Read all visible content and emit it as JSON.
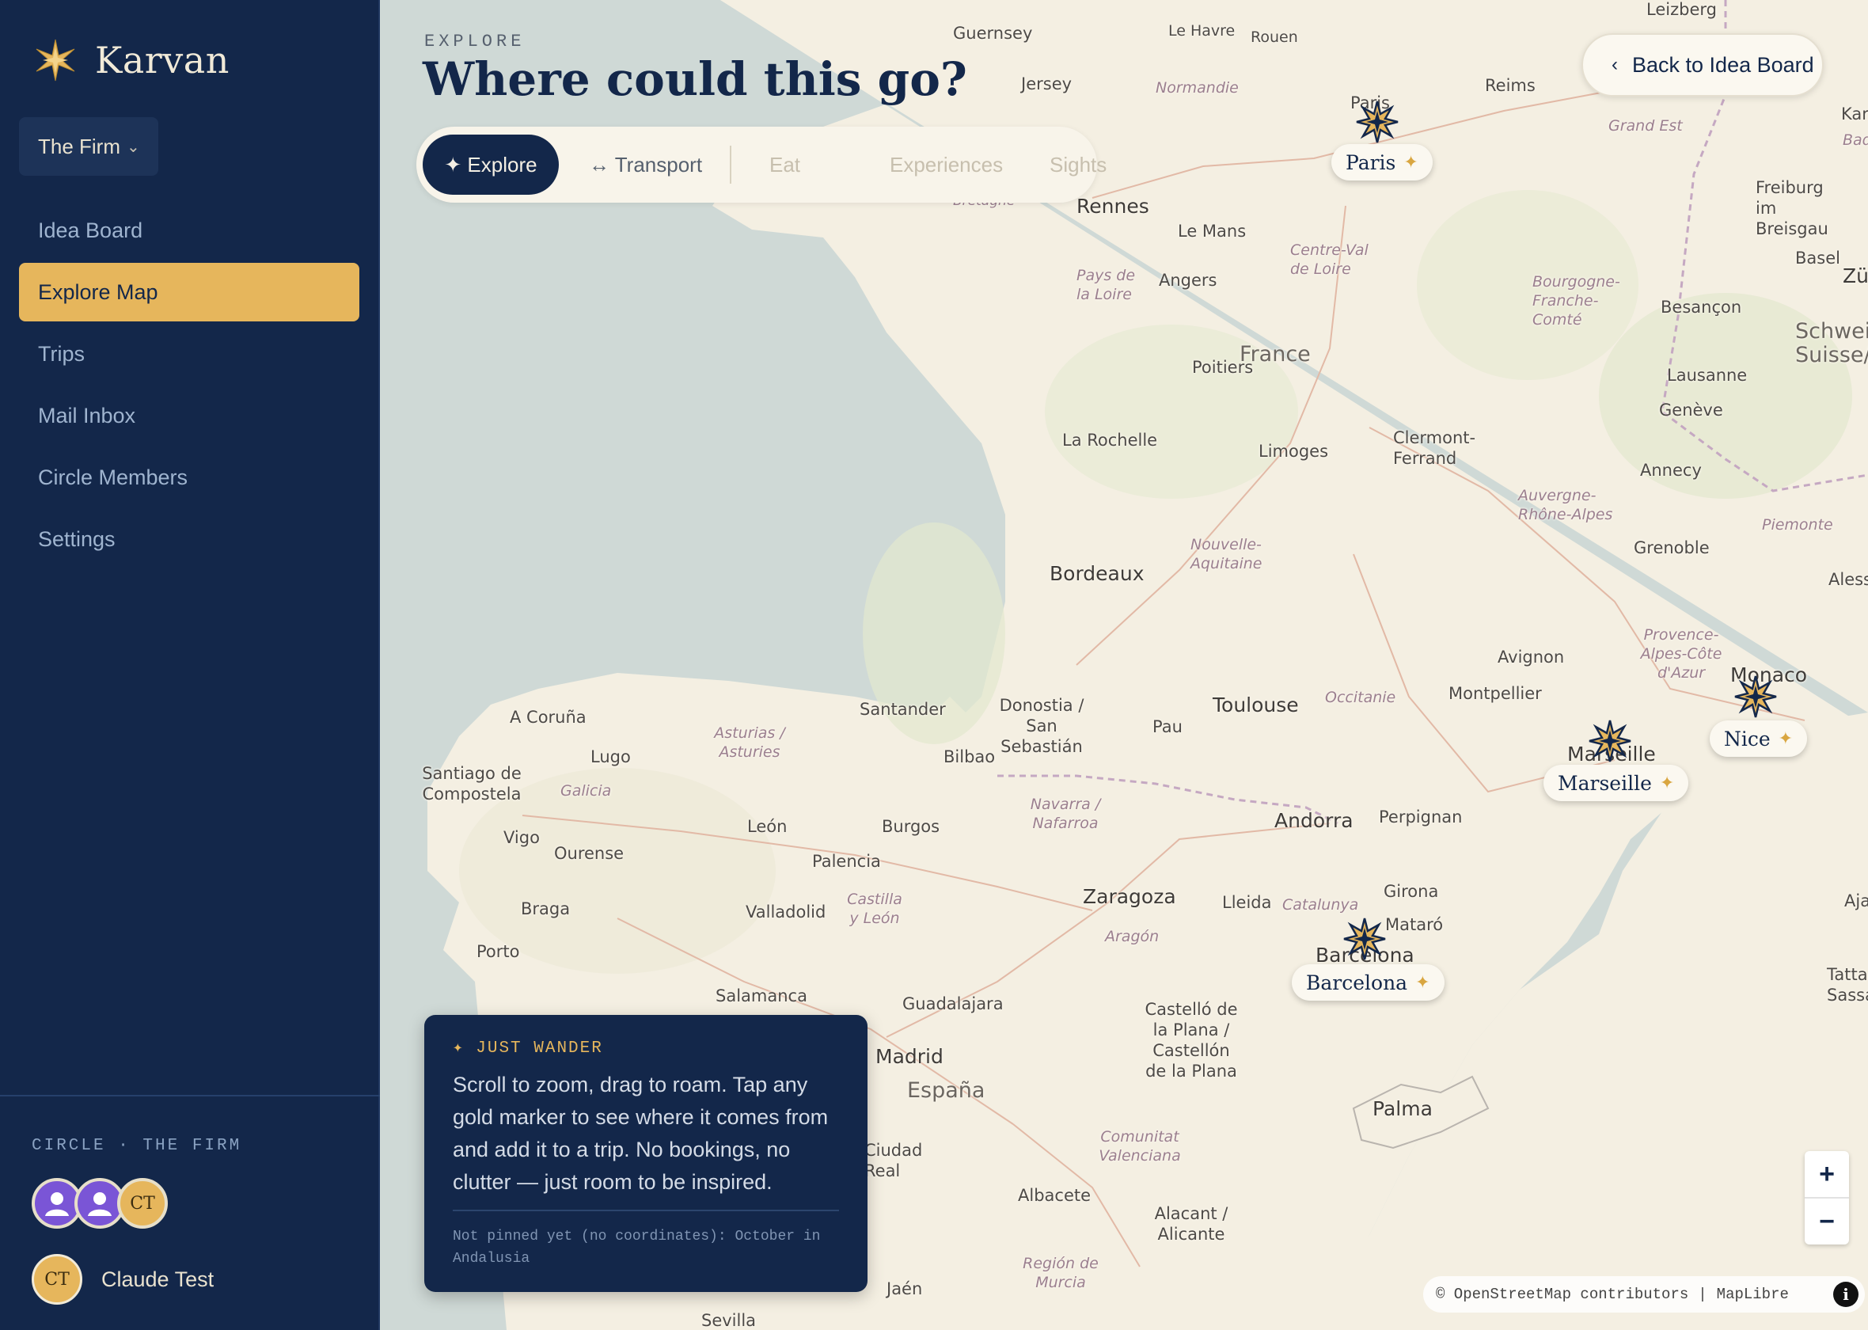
{
  "app": {
    "name": "Karvan",
    "circle_selector": "The Firm",
    "nav": [
      {
        "label": "Idea Board",
        "active": false
      },
      {
        "label": "Explore Map",
        "active": true
      },
      {
        "label": "Trips",
        "active": false
      },
      {
        "label": "Mail Inbox",
        "active": false
      },
      {
        "label": "Circle Members",
        "active": false
      },
      {
        "label": "Settings",
        "active": false
      }
    ],
    "circle_label": "CIRCLE · THE FIRM",
    "members": [
      {
        "initials": "",
        "icon": "user-icon",
        "color": "#7a55d6"
      },
      {
        "initials": "",
        "icon": "user-icon",
        "color": "#7a55d6"
      },
      {
        "initials": "CT",
        "color": "#e6b65c"
      }
    ],
    "user": {
      "initials": "CT",
      "name": "Claude Test"
    },
    "accent": "#e6b65c",
    "navy": "#13274a"
  },
  "header": {
    "eyebrow": "EXPLORE",
    "title": "Where could this go?",
    "back_button": "Back to Idea Board"
  },
  "tabs": [
    {
      "label": "✦ Explore",
      "active": true
    },
    {
      "label": "↔ Transport",
      "active": false
    },
    {
      "label": "Eat",
      "active": false,
      "disabled": true
    },
    {
      "label": "Experiences",
      "active": false,
      "disabled": true
    },
    {
      "label": "Sights",
      "active": false,
      "disabled": true
    }
  ],
  "markers": [
    {
      "name": "Paris"
    },
    {
      "name": "Nice"
    },
    {
      "name": "Marseille"
    },
    {
      "name": "Barcelona"
    }
  ],
  "map_labels": {
    "cities": [
      "Guernsey",
      "Jersey",
      "Le Havre",
      "Rouen",
      "Normandie",
      "Paris",
      "Reims",
      "Grand Est",
      "Karlsruhe",
      "Baden",
      "Rennes",
      "Le Mans",
      "Angers",
      "Centre-Val de Loire",
      "Pays de la Loire",
      "Bourgogne-Franche-Comté",
      "Besançon",
      "Freiburg im Breisgau",
      "Basel",
      "Zürich",
      "Schweiz Suisse/Svizzera",
      "Lausanne",
      "Genève",
      "Poitiers",
      "France",
      "La Rochelle",
      "Limoges",
      "Clermont-Ferrand",
      "Annecy",
      "Auvergne-Rhône-Alpes",
      "Grenoble",
      "Piemonte",
      "Bordeaux",
      "Nouvelle-Aquitaine",
      "Alessandria",
      "Avignon",
      "Provence-Alpes-Côte d'Azur",
      "Monaco",
      "Toulouse",
      "Occitanie",
      "Montpellier",
      "Marseille",
      "A Coruña",
      "Santander",
      "Donostia / San Sebastián",
      "Pau",
      "Asturias / Asturies",
      "Bilbao",
      "Lugo",
      "Santiago de Compostela",
      "Galicia",
      "Navarra / Nafarroa",
      "Andorra",
      "Perpignan",
      "León",
      "Burgos",
      "Vigo",
      "Ourense",
      "Palencia",
      "Zaragoza",
      "Girona",
      "Lleida",
      "Catalunya",
      "Castilla y León",
      "Aragón",
      "Mataró",
      "Braga",
      "Valladolid",
      "Barcelona",
      "Porto",
      "Salamanca",
      "Guadalajara",
      "Castelló de la Plana / Castellón de la Plana",
      "Madrid",
      "España",
      "Palma",
      "Ciudad Real",
      "Comunitat Valenciana",
      "Albacete",
      "Alacant / Alicante",
      "Región de Murcia",
      "Jaén",
      "Sevilla",
      "Bretagne",
      "Leizberg",
      "Tatta Sassa",
      "Aja"
    ]
  },
  "info_card": {
    "eyebrow": "✦ JUST WANDER",
    "body": "Scroll to zoom, drag to roam. Tap any gold marker to see where it comes from and add it to a trip. No bookings, no clutter — just room to be inspired.",
    "note": "Not pinned yet (no coordinates): October in Andalusia"
  },
  "zoom": {
    "in": "+",
    "out": "−"
  },
  "attribution": {
    "text": "© OpenStreetMap contributors",
    "sep": "|",
    "lib": "MapLibre",
    "info": "i"
  }
}
